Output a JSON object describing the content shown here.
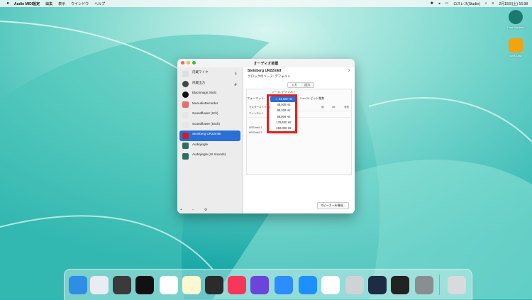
{
  "menubar": {
    "app_name": "Audio MIDI設定",
    "menus": [
      "編集",
      "表示",
      "ウインドウ",
      "ヘルプ"
    ],
    "status_items": [
      "ロスレス(Studio)"
    ],
    "clock": "2月15日(土) 16:38"
  },
  "desktop_icons": [
    {
      "label": "Time Machine",
      "icon": "time-machine-icon"
    },
    {
      "label": "USB Disk",
      "icon": "usb-drive-icon"
    }
  ],
  "window": {
    "title": "オーディオ装置",
    "devices": [
      {
        "name": "内蔵マイク",
        "sub": "",
        "icon": "microphone-icon",
        "right": "🎙"
      },
      {
        "name": "内蔵出力",
        "sub": "",
        "icon": "headphones-icon",
        "right": "🔊"
      },
      {
        "name": "Blackmagic Multi",
        "sub": "",
        "icon": "blackmagic-icon",
        "right": ""
      },
      {
        "name": "MuAudioRecorder",
        "sub": "",
        "icon": "recorder-icon",
        "right": ""
      },
      {
        "name": "Soundflower (2ch)",
        "sub": "",
        "icon": "soundflower-icon",
        "right": ""
      },
      {
        "name": "Soundflower (64ch)",
        "sub": "",
        "icon": "soundflower-icon",
        "right": ""
      },
      {
        "name": "Steinberg UR22mkII",
        "sub": "",
        "icon": "usb-audio-icon",
        "right": "",
        "selected": true
      },
      {
        "name": "Audiojingle",
        "sub": "",
        "icon": "audiojingle-icon",
        "right": ""
      },
      {
        "name": "Audiojingle (UI Sounds)",
        "sub": "",
        "icon": "audiojingle-icon",
        "right": ""
      }
    ],
    "footer_buttons": [
      "+",
      "−",
      "⚙"
    ],
    "detail": {
      "device_title": "Steinberg UR22mkII",
      "clock_source": "クロックのソース: デフォルト",
      "help": "?",
      "tabs": [
        "入力",
        "出力"
      ],
      "active_tab": "入力",
      "source_label": "ソース: デフォルト",
      "format_label": "フォーマット:",
      "format_value": "2 ch 24 ビット整数",
      "columns": [
        "値",
        "dB",
        "消音"
      ],
      "rows": [
        "マスターストリーム",
        "チャンネル 1",
        "UR22mkII 1",
        "UR22mkII 2"
      ],
      "speaker_button": "スピーカーを構成..."
    }
  },
  "dropdown": {
    "options": [
      "✓ 44,100 Hz",
      "48,000 Hz",
      "88,200 Hz",
      "96,000 Hz",
      "176,400 Hz",
      "192,000 Hz"
    ],
    "selected_index": 0
  },
  "dock": [
    {
      "name": "finder",
      "icon": "finder-icon",
      "color": "#2f8de4"
    },
    {
      "name": "launchpad",
      "icon": "launchpad-icon",
      "color": "#e9ecf2"
    },
    {
      "name": "disk-utility",
      "icon": "disk-utility-icon",
      "color": "#3a3a3a"
    },
    {
      "name": "audio-app",
      "icon": "audio-app-icon",
      "color": "#111111"
    },
    {
      "name": "chrome",
      "icon": "chrome-icon",
      "color": "#ffffff"
    },
    {
      "name": "notes",
      "icon": "notes-icon",
      "color": "#fff8d0"
    },
    {
      "name": "calculator",
      "icon": "calculator-icon",
      "color": "#2b2b2b"
    },
    {
      "name": "music",
      "icon": "music-icon",
      "color": "#f8365a"
    },
    {
      "name": "imovie",
      "icon": "star-icon",
      "color": "#6b44d9"
    },
    {
      "name": "zoom",
      "icon": "zoom-icon",
      "color": "#2d8cff"
    },
    {
      "name": "app-store",
      "icon": "app-store-icon",
      "color": "#1e8fff"
    },
    {
      "name": "evernote",
      "icon": "evernote-icon",
      "color": "#ffffff"
    },
    {
      "name": "dvd-player",
      "icon": "dvd-icon",
      "color": "#cfd3d6"
    },
    {
      "name": "quicktime",
      "icon": "quicktime-icon",
      "color": "#1d2b44"
    },
    {
      "name": "piano",
      "icon": "piano-icon",
      "color": "#222222"
    },
    {
      "name": "system-preferences",
      "icon": "gear-icon",
      "color": "#8a8d91"
    },
    {
      "name": "trash",
      "icon": "trash-icon",
      "color": "#d8dadc"
    }
  ]
}
